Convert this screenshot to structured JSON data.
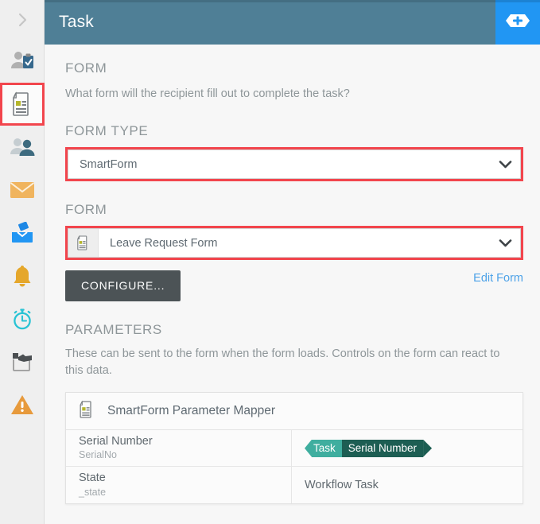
{
  "sidebar": {
    "toggle": {
      "icon": "chevron-right-icon"
    },
    "items": [
      {
        "icon": "person-clipboard-icon",
        "label": "Approval",
        "selected": false
      },
      {
        "icon": "document-form-icon",
        "label": "Task",
        "selected": true
      },
      {
        "icon": "two-people-icon",
        "label": "Group Task",
        "selected": false
      },
      {
        "icon": "envelope-icon",
        "label": "Email",
        "selected": false
      },
      {
        "icon": "inbox-tray-icon",
        "label": "Publish",
        "selected": false
      },
      {
        "icon": "bell-icon",
        "label": "Notification",
        "selected": false
      },
      {
        "icon": "stopwatch-icon",
        "label": "Timer",
        "selected": false
      },
      {
        "icon": "hand-box-icon",
        "label": "Manual Action",
        "selected": false
      },
      {
        "icon": "warning-triangle-icon",
        "label": "Exception",
        "selected": false
      }
    ]
  },
  "header": {
    "title": "Task",
    "add_button_icon": "add-node-icon",
    "bg_color": "#4f7f96",
    "add_button_color": "#2196f3"
  },
  "form_section": {
    "heading": "FORM",
    "description": "What form will the recipient fill out to complete the task?"
  },
  "form_type": {
    "label": "FORM TYPE",
    "value": "SmartForm",
    "caret_icon": "chevron-down-icon",
    "highlighted": true,
    "highlight_color": "#f2454d"
  },
  "form_field": {
    "label": "FORM",
    "icon": "document-form-icon",
    "value": "Leave Request Form",
    "caret_icon": "chevron-down-icon",
    "highlighted": true,
    "highlight_color": "#f2454d"
  },
  "actions": {
    "configure_label": "CONFIGURE...",
    "edit_form_label": "Edit Form",
    "link_color": "#4da2e8"
  },
  "parameters": {
    "heading": "PARAMETERS",
    "description": "These can be sent to the form when the form loads. Controls on the form can react to this data.",
    "panel_title": "SmartForm Parameter Mapper",
    "panel_icon": "document-form-icon",
    "rows": [
      {
        "title": "Serial Number",
        "sub": "SerialNo",
        "value_type": "chip",
        "chip": {
          "scope": "Task",
          "field": "Serial Number",
          "scope_color": "#3fae9f",
          "field_color": "#1d5e53"
        },
        "value_text": ""
      },
      {
        "title": "State",
        "sub": "_state",
        "value_type": "text",
        "value_text": "Workflow Task"
      }
    ]
  }
}
